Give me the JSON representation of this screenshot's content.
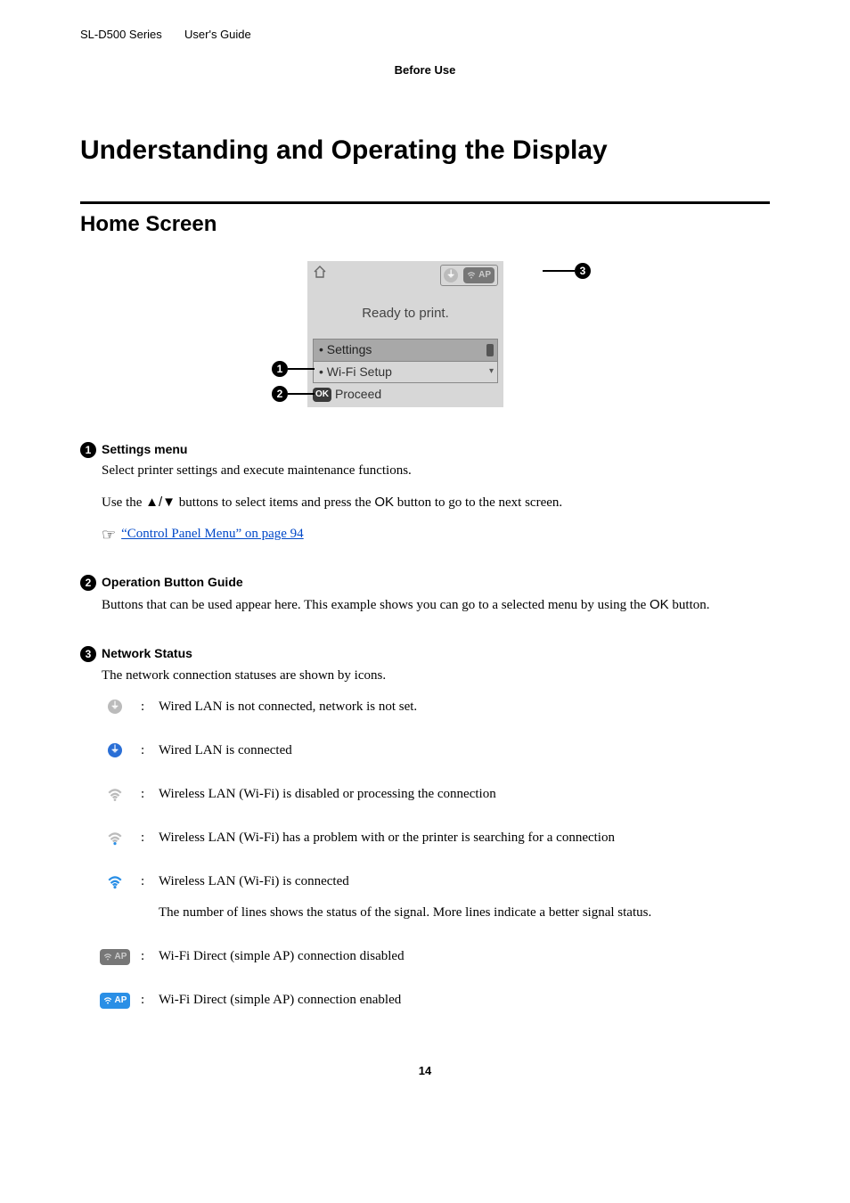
{
  "header": {
    "series": "SL-D500 Series",
    "guide": "User's Guide"
  },
  "section_label": "Before Use",
  "h1": "Understanding and Operating the Display",
  "h2": "Home Screen",
  "screen": {
    "status_text": "Ready to print.",
    "menu": {
      "item1": "Settings",
      "item2": "Wi-Fi Setup"
    },
    "proceed": "Proceed",
    "ok_badge": "OK"
  },
  "callouts": {
    "c1": "1",
    "c2": "2",
    "c3": "3"
  },
  "items": {
    "i1": {
      "num": "1",
      "title": "Settings menu",
      "p1": "Select printer settings and execute maintenance functions.",
      "p2_a": "Use the ",
      "p2_keys": "▲/▼",
      "p2_b": " buttons to select items and press the ",
      "p2_ok": "OK",
      "p2_c": " button to go to the next screen.",
      "link": "“Control Panel Menu” on page 94"
    },
    "i2": {
      "num": "2",
      "title": "Operation Button Guide",
      "p_a": "Buttons that can be used appear here. This example shows you can go to a selected menu by using the ",
      "p_ok": "OK",
      "p_b": " button."
    },
    "i3": {
      "num": "3",
      "title": "Network Status",
      "p1": "The network connection statuses are shown by icons.",
      "rows": {
        "r1": "Wired LAN is not connected, network is not set.",
        "r2": "Wired LAN is connected",
        "r3": "Wireless LAN (Wi-Fi) is disabled or processing the connection",
        "r4": "Wireless LAN (Wi-Fi) has a problem with or the printer is searching for a connection",
        "r5a": "Wireless LAN (Wi-Fi) is connected",
        "r5b": "The number of lines shows the status of the signal. More lines indicate a better signal status.",
        "r6": "Wi-Fi Direct (simple AP) connection disabled",
        "r7": "Wi-Fi Direct (simple AP) connection enabled"
      },
      "ap_label": "AP"
    }
  },
  "page_number": "14"
}
